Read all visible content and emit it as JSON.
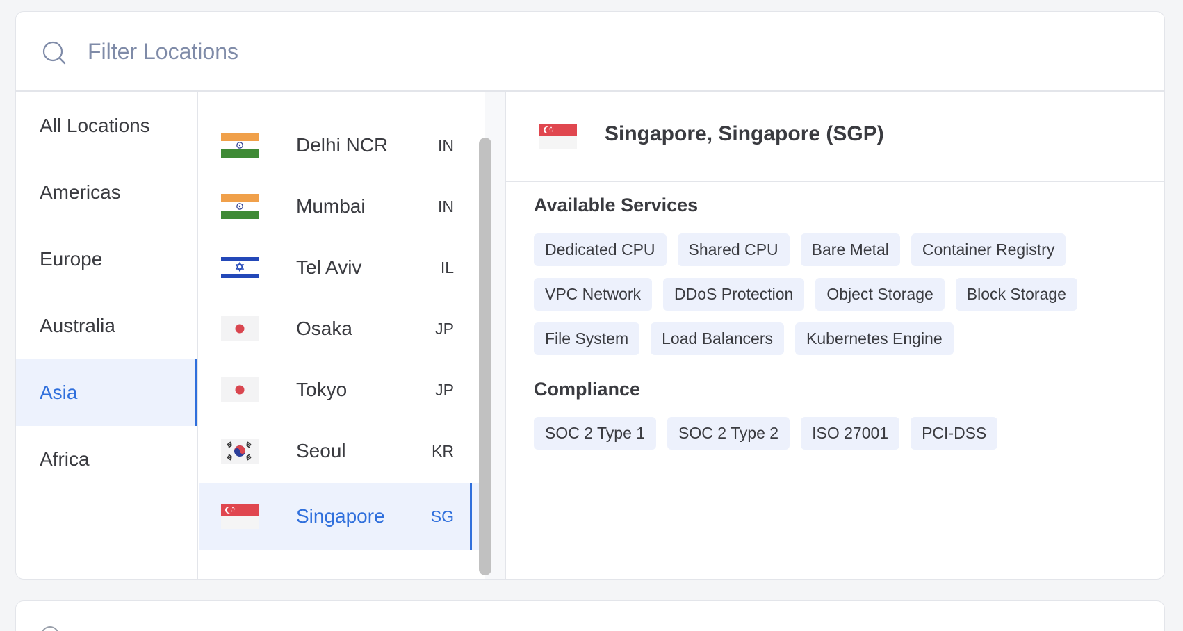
{
  "search": {
    "placeholder": "Filter Locations"
  },
  "regions": [
    {
      "label": "All Locations"
    },
    {
      "label": "Americas"
    },
    {
      "label": "Europe"
    },
    {
      "label": "Australia"
    },
    {
      "label": "Asia",
      "active": true
    },
    {
      "label": "Africa"
    }
  ],
  "cities": [
    {
      "name": "Delhi NCR",
      "code": "IN",
      "flag": "india-flag-icon"
    },
    {
      "name": "Mumbai",
      "code": "IN",
      "flag": "india-flag-icon"
    },
    {
      "name": "Tel Aviv",
      "code": "IL",
      "flag": "israel-flag-icon"
    },
    {
      "name": "Osaka",
      "code": "JP",
      "flag": "japan-flag-icon"
    },
    {
      "name": "Tokyo",
      "code": "JP",
      "flag": "japan-flag-icon"
    },
    {
      "name": "Seoul",
      "code": "KR",
      "flag": "south-korea-flag-icon"
    },
    {
      "name": "Singapore",
      "code": "SG",
      "flag": "singapore-flag-icon",
      "active": true
    }
  ],
  "detail": {
    "title": "Singapore, Singapore (SGP)",
    "flag": "singapore-flag-icon",
    "services_title": "Available Services",
    "services": [
      "Dedicated CPU",
      "Shared CPU",
      "Bare Metal",
      "Container Registry",
      "VPC Network",
      "DDoS Protection",
      "Object Storage",
      "Block Storage",
      "File System",
      "Load Balancers",
      "Kubernetes Engine"
    ],
    "compliance_title": "Compliance",
    "compliance": [
      "SOC 2 Type 1",
      "SOC 2 Type 2",
      "ISO 27001",
      "PCI-DSS"
    ]
  },
  "colors": {
    "accent": "#2f6fdc",
    "active_bg": "#edf2fd",
    "chip_bg": "#edf1fc",
    "text": "#3a3b40",
    "placeholder": "#7f8ba8"
  }
}
